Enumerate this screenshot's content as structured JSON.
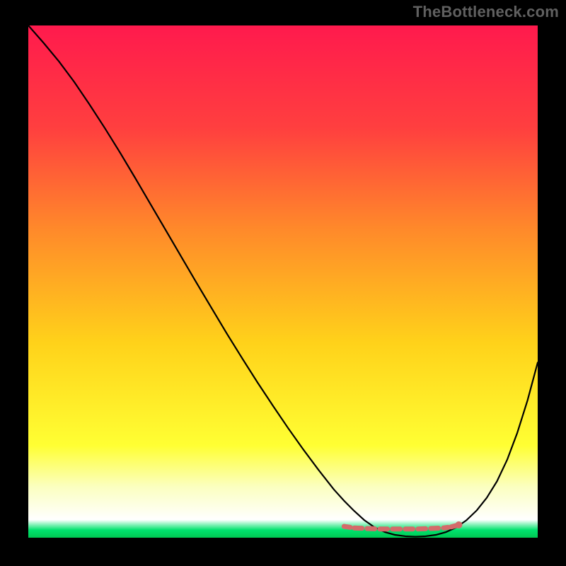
{
  "watermark": "TheBottleneck.com",
  "chart_data": {
    "type": "line",
    "title": "",
    "xlabel": "",
    "ylabel": "",
    "xlim": [
      0,
      100
    ],
    "ylim": [
      0,
      100
    ],
    "background_gradient": {
      "stops": [
        {
          "offset": 0.0,
          "color": "#ff1a4d"
        },
        {
          "offset": 0.2,
          "color": "#ff3f3f"
        },
        {
          "offset": 0.4,
          "color": "#ff8a2a"
        },
        {
          "offset": 0.62,
          "color": "#ffd21a"
        },
        {
          "offset": 0.82,
          "color": "#ffff33"
        },
        {
          "offset": 0.9,
          "color": "#fbffbf"
        },
        {
          "offset": 0.965,
          "color": "#ffffff"
        },
        {
          "offset": 0.985,
          "color": "#00e36e"
        },
        {
          "offset": 1.0,
          "color": "#00c853"
        }
      ]
    },
    "series": [
      {
        "name": "bottleneck-curve",
        "color": "#000000",
        "width": 2.2,
        "x": [
          0,
          3,
          6,
          9,
          12,
          15,
          18,
          21,
          24,
          27,
          30,
          33,
          36,
          39,
          42,
          45,
          48,
          51,
          54,
          57,
          60,
          62,
          64,
          66,
          68,
          70,
          72,
          74,
          76,
          78,
          80,
          82,
          84,
          86,
          88,
          90,
          92,
          94,
          96,
          98,
          100
        ],
        "y": [
          100,
          96.6,
          93,
          89,
          84.6,
          80,
          75.2,
          70.2,
          65.1,
          60,
          54.9,
          49.8,
          44.8,
          39.8,
          35,
          30.3,
          25.8,
          21.4,
          17.2,
          13.2,
          9.4,
          7.2,
          5.2,
          3.4,
          2.0,
          1.1,
          0.55,
          0.28,
          0.2,
          0.28,
          0.55,
          1.1,
          2.0,
          3.4,
          5.3,
          7.8,
          11.0,
          15.2,
          20.5,
          26.8,
          34.2
        ]
      }
    ],
    "marker_band": {
      "name": "optimal-range",
      "color": "#d46a6a",
      "width": 7,
      "points": [
        {
          "x": 62.0,
          "y": 2.2
        },
        {
          "x": 64.0,
          "y": 1.9
        },
        {
          "x": 66.5,
          "y": 1.8
        },
        {
          "x": 69.0,
          "y": 1.7
        },
        {
          "x": 71.5,
          "y": 1.7
        },
        {
          "x": 74.0,
          "y": 1.7
        },
        {
          "x": 76.5,
          "y": 1.7
        },
        {
          "x": 79.0,
          "y": 1.8
        },
        {
          "x": 81.5,
          "y": 1.9
        },
        {
          "x": 83.0,
          "y": 2.1
        },
        {
          "x": 84.5,
          "y": 2.5
        }
      ],
      "end_dot": {
        "x": 84.5,
        "y": 2.5,
        "r": 5
      }
    }
  }
}
